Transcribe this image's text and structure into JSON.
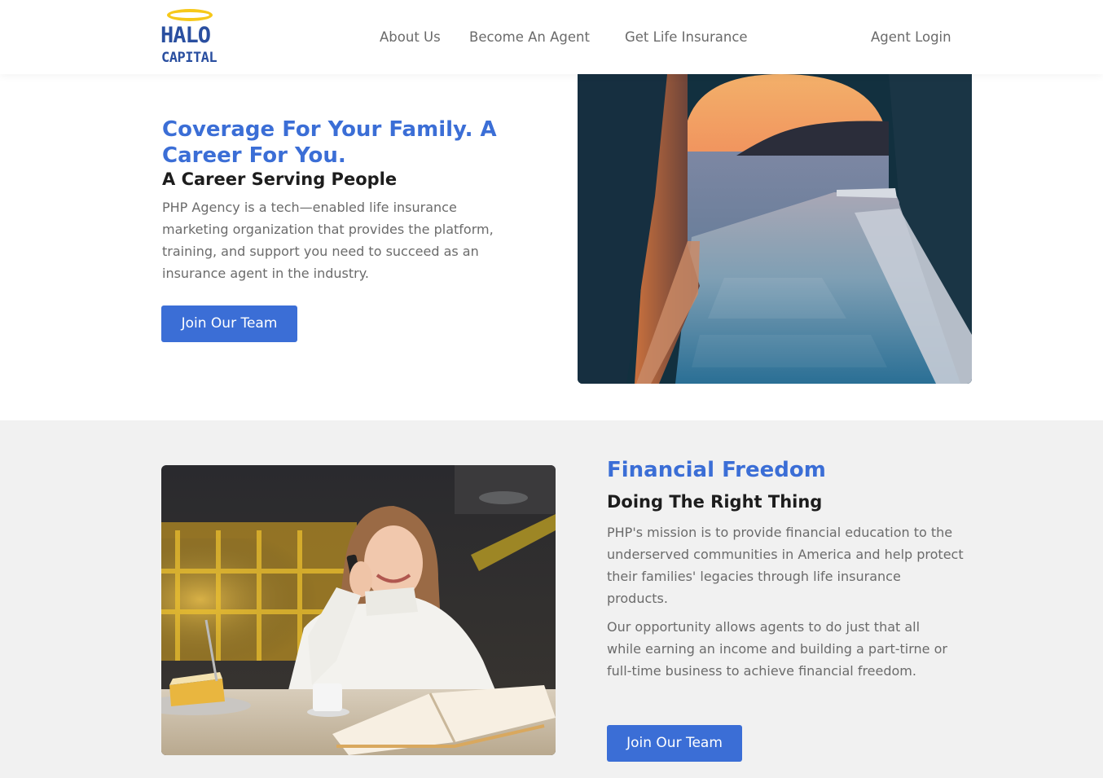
{
  "header": {
    "logo": {
      "line1": "HALO",
      "line2": "CAPITAL"
    },
    "nav": {
      "about": "About Us",
      "become": "Become An Agent",
      "get": "Get Life Insurance",
      "login": "Agent Login"
    }
  },
  "hero": {
    "headline": "Coverage For Your Family. A Career For You.",
    "subhead": "A Career Serving People",
    "body": "PHP Agency is a tech—enabled life insurance marketing organization that provides the platform, training, and support you need to succeed as an insurance agent in the industry.",
    "button": "Join Our Team",
    "image": "sunset-pool-arch-photo"
  },
  "freedom": {
    "headline": "Financial Freedom",
    "subhead": "Doing The Right Thing",
    "body1": "PHP's mission is to provide financial education to the underserved communities in America and help protect their families' legacies through life insurance products.",
    "body2": "Our opportunity allows agents to do just that all while earning an income and building a part-tirne or full-time business to achieve financial freedom.",
    "button": "Join Our Team",
    "image": "woman-on-phone-cafe-photo"
  },
  "colors": {
    "accent": "#3b6ed6",
    "logo_blue": "#2a4fa0",
    "logo_gold": "#f6c81a",
    "alt_section_bg": "#f1f1f1"
  }
}
